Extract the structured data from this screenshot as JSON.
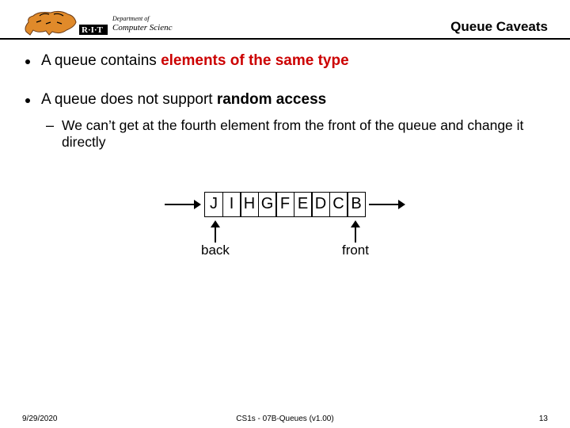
{
  "header": {
    "logo_text_institution": "R·I·T",
    "logo_text_dept_prefix": "Department of",
    "logo_text_dept": "Computer Science",
    "title": "Queue Caveats"
  },
  "bullets": [
    {
      "lead": "A queue contains ",
      "emphasis": "elements of the same type",
      "emphasis_style": "red"
    },
    {
      "lead": "A queue does not support ",
      "emphasis": "random access",
      "emphasis_style": "black",
      "sub": "We can’t get at the fourth element from the front of the queue and change it directly"
    }
  ],
  "queue": {
    "cells": [
      "J",
      "I",
      "H",
      "G",
      "F",
      "E",
      "D",
      "C",
      "B"
    ],
    "back_label": "back",
    "front_label": "front"
  },
  "footer": {
    "date": "9/29/2020",
    "course": "CS1s - 07B-Queues (v1.00)",
    "page": "13"
  }
}
